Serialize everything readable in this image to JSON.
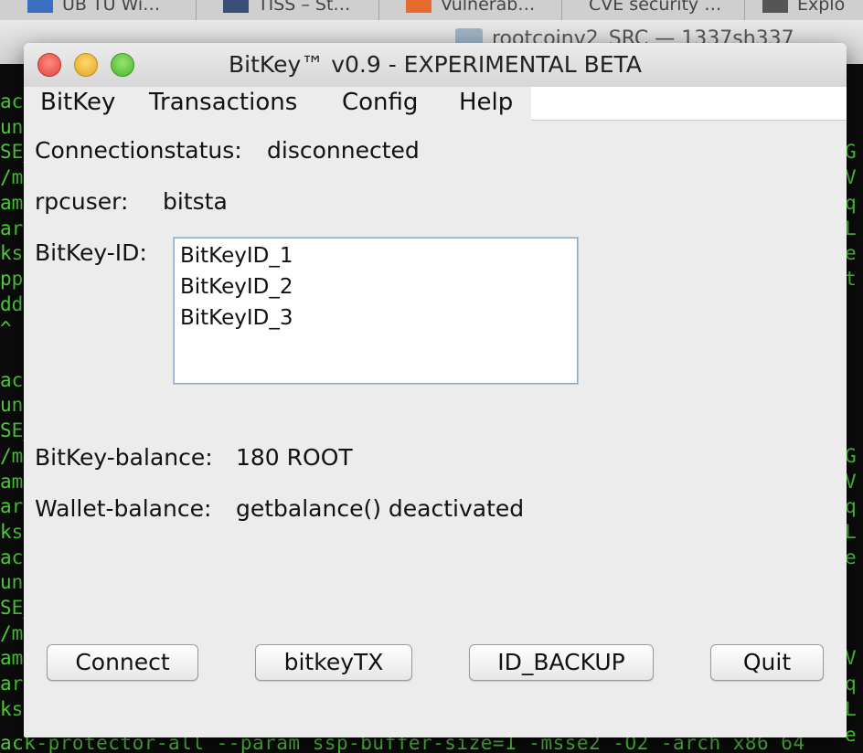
{
  "browser_tabs": [
    {
      "label": "UB TU Wi…"
    },
    {
      "label": "TISS – St…"
    },
    {
      "label": "Vulnerab…"
    },
    {
      "label": "CVE security …"
    },
    {
      "label": "Explo"
    }
  ],
  "finder": {
    "title": "rootcoinv2_SRC — 1337sh337"
  },
  "terminal": {
    "left_fragments": [
      "ack",
      "unn",
      "SE_",
      "/ma",
      "ame",
      "ary",
      "ks",
      "pp",
      "dd",
      "^",
      "",
      "ack",
      "unn",
      "SE_",
      "/ma",
      "ame",
      "ary",
      "ks",
      "ack",
      "unn",
      "SE_",
      "/ma",
      "ame",
      "ary",
      "ks"
    ],
    "right_fragments": [
      "",
      "",
      "G",
      "V",
      "q",
      "L",
      "e",
      "t",
      "",
      "",
      "",
      "",
      "",
      "",
      "G",
      "V",
      "q",
      "L",
      "e",
      "",
      "",
      "",
      "V",
      "q",
      "L",
      "e"
    ],
    "bottom_line": "ack-protector-all --param ssp-buffer-size=1 -msse2 -O2 -arch x86_64"
  },
  "window": {
    "title": "BitKey™ v0.9 - EXPERIMENTAL BETA",
    "menu": [
      "BitKey",
      "Transactions",
      "Config",
      "Help"
    ]
  },
  "status": {
    "connection_label": "Connectionstatus:",
    "connection_value": "disconnected",
    "rpcuser_label": "rpcuser:",
    "rpcuser_value": "bitsta",
    "bitkey_id_label": "BitKey-ID:",
    "bitkey_ids": [
      "BitKeyID_1",
      "BitKeyID_2",
      "BitKeyID_3"
    ],
    "bitkey_balance_label": "BitKey-balance:",
    "bitkey_balance_value": "180 ROOT",
    "wallet_balance_label": "Wallet-balance:",
    "wallet_balance_value": "getbalance() deactivated"
  },
  "buttons": {
    "connect": "Connect",
    "bitkeytx": "bitkeyTX",
    "id_backup": "ID_BACKUP",
    "quit": "Quit"
  }
}
